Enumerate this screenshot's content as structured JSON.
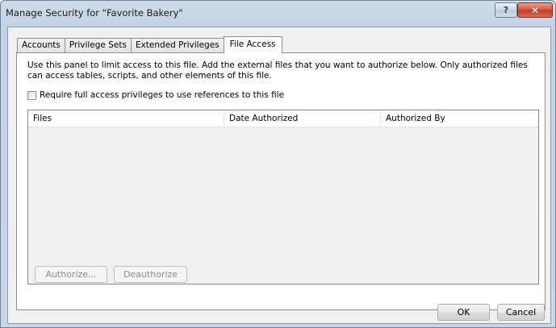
{
  "window": {
    "title": "Manage Security for \"Favorite Bakery\"",
    "help_glyph": "?",
    "close_glyph": "✕"
  },
  "tabs": [
    {
      "label": "Accounts",
      "active": false
    },
    {
      "label": "Privilege Sets",
      "active": false
    },
    {
      "label": "Extended Privileges",
      "active": false
    },
    {
      "label": "File Access",
      "active": true
    }
  ],
  "panel": {
    "description": "Use this panel to limit access to this file.  Add the external files that you want to authorize below.  Only authorized files can access tables, scripts, and other elements of this file.",
    "require_checkbox_label": "Require full access privileges to use references to this file",
    "require_checked": false
  },
  "table": {
    "columns": [
      "Files",
      "Date Authorized",
      "Authorized By"
    ],
    "rows": []
  },
  "buttons": {
    "authorize": "Authorize...",
    "deauthorize": "Deauthorize",
    "ok": "OK",
    "cancel": "Cancel"
  },
  "icons": {
    "help": "help-icon",
    "close": "close-icon",
    "checkbox": "checkbox-unchecked"
  }
}
